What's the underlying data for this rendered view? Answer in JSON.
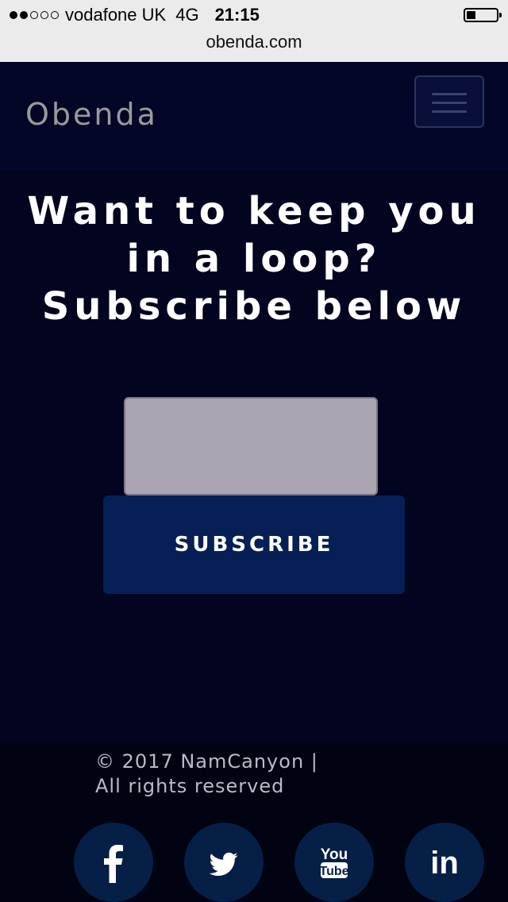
{
  "status_bar": {
    "signal_filled": 2,
    "signal_total": 5,
    "carrier": "vodafone UK",
    "network": "4G",
    "time": "21:15",
    "battery_level": 0.3,
    "url": "obenda.com"
  },
  "navbar": {
    "brand": "Obenda",
    "menu_icon": "hamburger-menu-icon"
  },
  "main": {
    "heading_lines": [
      "Want to keep you",
      "in a loop?",
      "Subscribe below"
    ],
    "email_input": {
      "value": "",
      "placeholder": ""
    },
    "subscribe_label": "SUBSCRIBE"
  },
  "footer": {
    "copyright_line1": "© 2017 NamCanyon |",
    "copyright_line2": "All rights reserved",
    "social": [
      {
        "icon": "facebook-icon"
      },
      {
        "icon": "twitter-icon"
      },
      {
        "icon": "youtube-icon",
        "text_top": "You",
        "text_bottom": "Tube"
      },
      {
        "icon": "linkedin-icon",
        "text": "in"
      }
    ]
  },
  "colors": {
    "background": "#03041f",
    "navbar": "#030626",
    "button": "#061f54",
    "social_circle": "#061f47",
    "input": "#aaa5b0"
  }
}
